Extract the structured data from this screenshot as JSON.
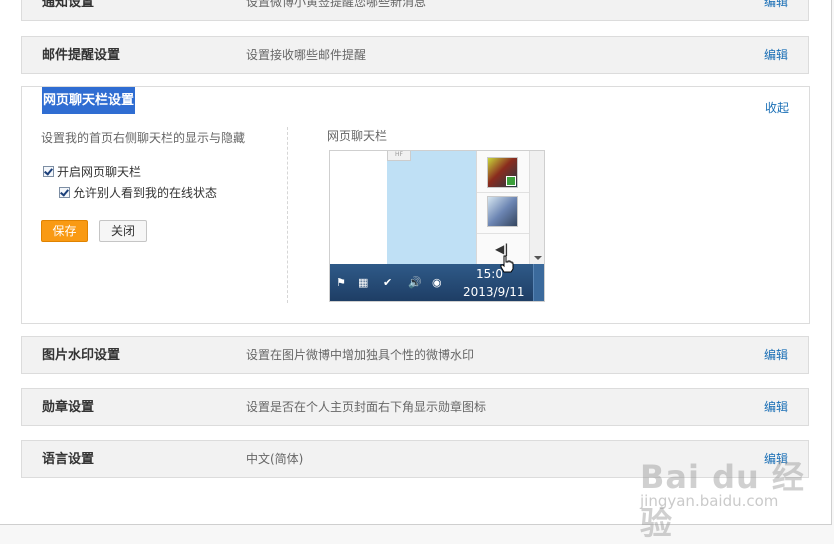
{
  "rows": [
    {
      "title": "通知设置",
      "desc": "设置微博小黄签提醒您哪些新消息",
      "edit": "编辑"
    },
    {
      "title": "邮件提醒设置",
      "desc": "设置接收哪些邮件提醒",
      "edit": "编辑"
    },
    {
      "title": "图片水印设置",
      "desc": "设置在图片微博中增加独具个性的微博水印",
      "edit": "编辑"
    },
    {
      "title": "勋章设置",
      "desc": "设置是否在个人主页封面右下角显示勋章图标",
      "edit": "编辑"
    },
    {
      "title": "语言设置",
      "desc": "中文(简体)",
      "edit": "编辑"
    }
  ],
  "chat_panel": {
    "title": "网页聊天栏设置",
    "collapse": "收起",
    "description": "设置我的首页右侧聊天栏的显示与隐藏",
    "checkbox_enable": {
      "label": "开启网页聊天栏",
      "checked": true
    },
    "checkbox_online": {
      "label": "允许别人看到我的在线状态",
      "checked": true
    },
    "save": "保存",
    "close": "关闭",
    "preview_label": "网页聊天栏",
    "preview": {
      "time": "15:0",
      "date": "2013/9/11",
      "mini_tab": "HF"
    }
  },
  "watermark": {
    "brand": "Bai du 经验",
    "url": "jingyan.baidu.com"
  },
  "colors": {
    "link": "#1a6fb6",
    "save_button": "#f99a13",
    "title_highlight": "#2f6dd2"
  }
}
